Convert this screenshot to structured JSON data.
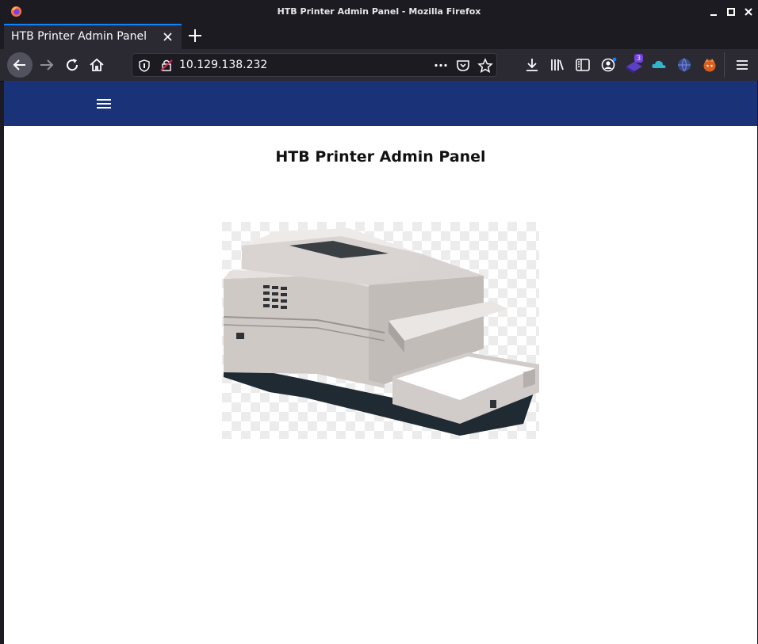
{
  "window": {
    "title": "HTB Printer Admin Panel - Mozilla Firefox"
  },
  "tab": {
    "title": "HTB Printer Admin Panel"
  },
  "addressbar": {
    "url": "10.129.138.232"
  },
  "toolbar": {
    "extension_badge": "3"
  },
  "page": {
    "heading": "HTB Printer Admin Panel",
    "navbar_color": "#1a3277"
  },
  "colors": {
    "accent": "#0a84ff",
    "chrome": "#2b2a33",
    "titlebar": "#1c1b22"
  }
}
